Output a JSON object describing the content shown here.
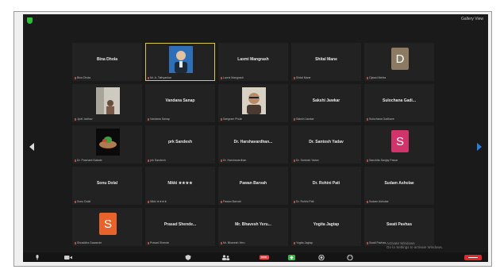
{
  "topbar": {
    "view_label": "Gallery View"
  },
  "tiles": [
    {
      "name": "Bina Dhola",
      "foot": "Bina Dhola",
      "type": "name"
    },
    {
      "name": "",
      "foot": "Mr. A. Tathyankar",
      "type": "photo",
      "photo": "man-blue",
      "active": true
    },
    {
      "name": "Laxmi Mangrash",
      "foot": "Laxmi Mangrash",
      "type": "name"
    },
    {
      "name": "Shital Mane",
      "foot": "Shital Mane",
      "type": "name"
    },
    {
      "name": "",
      "foot": "Ojaswi Mehta",
      "type": "avatar",
      "letter": "D",
      "color": "#8c7a62"
    },
    {
      "name": "",
      "foot": "Jyoti Jadhav",
      "type": "photo",
      "photo": "room"
    },
    {
      "name": "Vandana Sanap",
      "foot": "Vandana Sanap",
      "type": "name"
    },
    {
      "name": "",
      "foot": "Sangram Phule",
      "type": "photo",
      "photo": "man-glasses"
    },
    {
      "name": "Sakshi Jawkar",
      "foot": "Sakshi Jawkar",
      "type": "name"
    },
    {
      "name": "Sulochana Gadi...",
      "foot": "Sulochana Gadhave",
      "type": "name"
    },
    {
      "name": "",
      "foot": "Dr. Prashant Nakate",
      "type": "photo",
      "photo": "hands"
    },
    {
      "name": "prk Sandesh",
      "foot": "prk Sandesh",
      "type": "name"
    },
    {
      "name": "Dr. Harshavardhan...",
      "foot": "Dr. Harshavardhan",
      "type": "name"
    },
    {
      "name": "Dr. Santosh Yadav",
      "foot": "Dr. Santosh Yadav",
      "type": "name"
    },
    {
      "name": "",
      "foot": "Sanchita Sanjay Pawar",
      "type": "avatar",
      "letter": "S",
      "color": "#d1336b"
    },
    {
      "name": "Sonu Dolal",
      "foot": "Sonu Dolal",
      "type": "name"
    },
    {
      "name": "Nikki ★★★★",
      "foot": "Nikki ★★★★",
      "type": "name"
    },
    {
      "name": "Pawan Barvah",
      "foot": "Pawan Barvah",
      "type": "name"
    },
    {
      "name": "Dr. Rohini Pati",
      "foot": "Dr. Rohini Pati",
      "type": "name"
    },
    {
      "name": "Sudam Asholae",
      "foot": "Sudam Asholae",
      "type": "name"
    },
    {
      "name": "",
      "foot": "Shraddha Gawande",
      "type": "avatar",
      "letter": "S",
      "color": "#e8622c"
    },
    {
      "name": "Prasad Shende...",
      "foot": "Prasad Shende",
      "type": "name"
    },
    {
      "name": "Mr. Bhavesh Yeru...",
      "foot": "Mr. Bhavesh Yeru",
      "type": "name"
    },
    {
      "name": "Yogita Jagtap",
      "foot": "Yogita Jagtap",
      "type": "name"
    },
    {
      "name": "Swati Pavhas",
      "foot": "Swati Pavhas",
      "type": "name"
    }
  ],
  "watermark": {
    "line1": "Activate Windows",
    "line2": "Go to Settings to activate Windows."
  },
  "toolbar": {
    "items": [
      "mic",
      "video",
      "security",
      "participants",
      "chat",
      "share",
      "record",
      "reactions",
      "end"
    ]
  },
  "colors": {
    "background": "#1a1a1a",
    "active_border": "#d7c84b",
    "share": "#2dbd3a",
    "end": "#e02828"
  }
}
